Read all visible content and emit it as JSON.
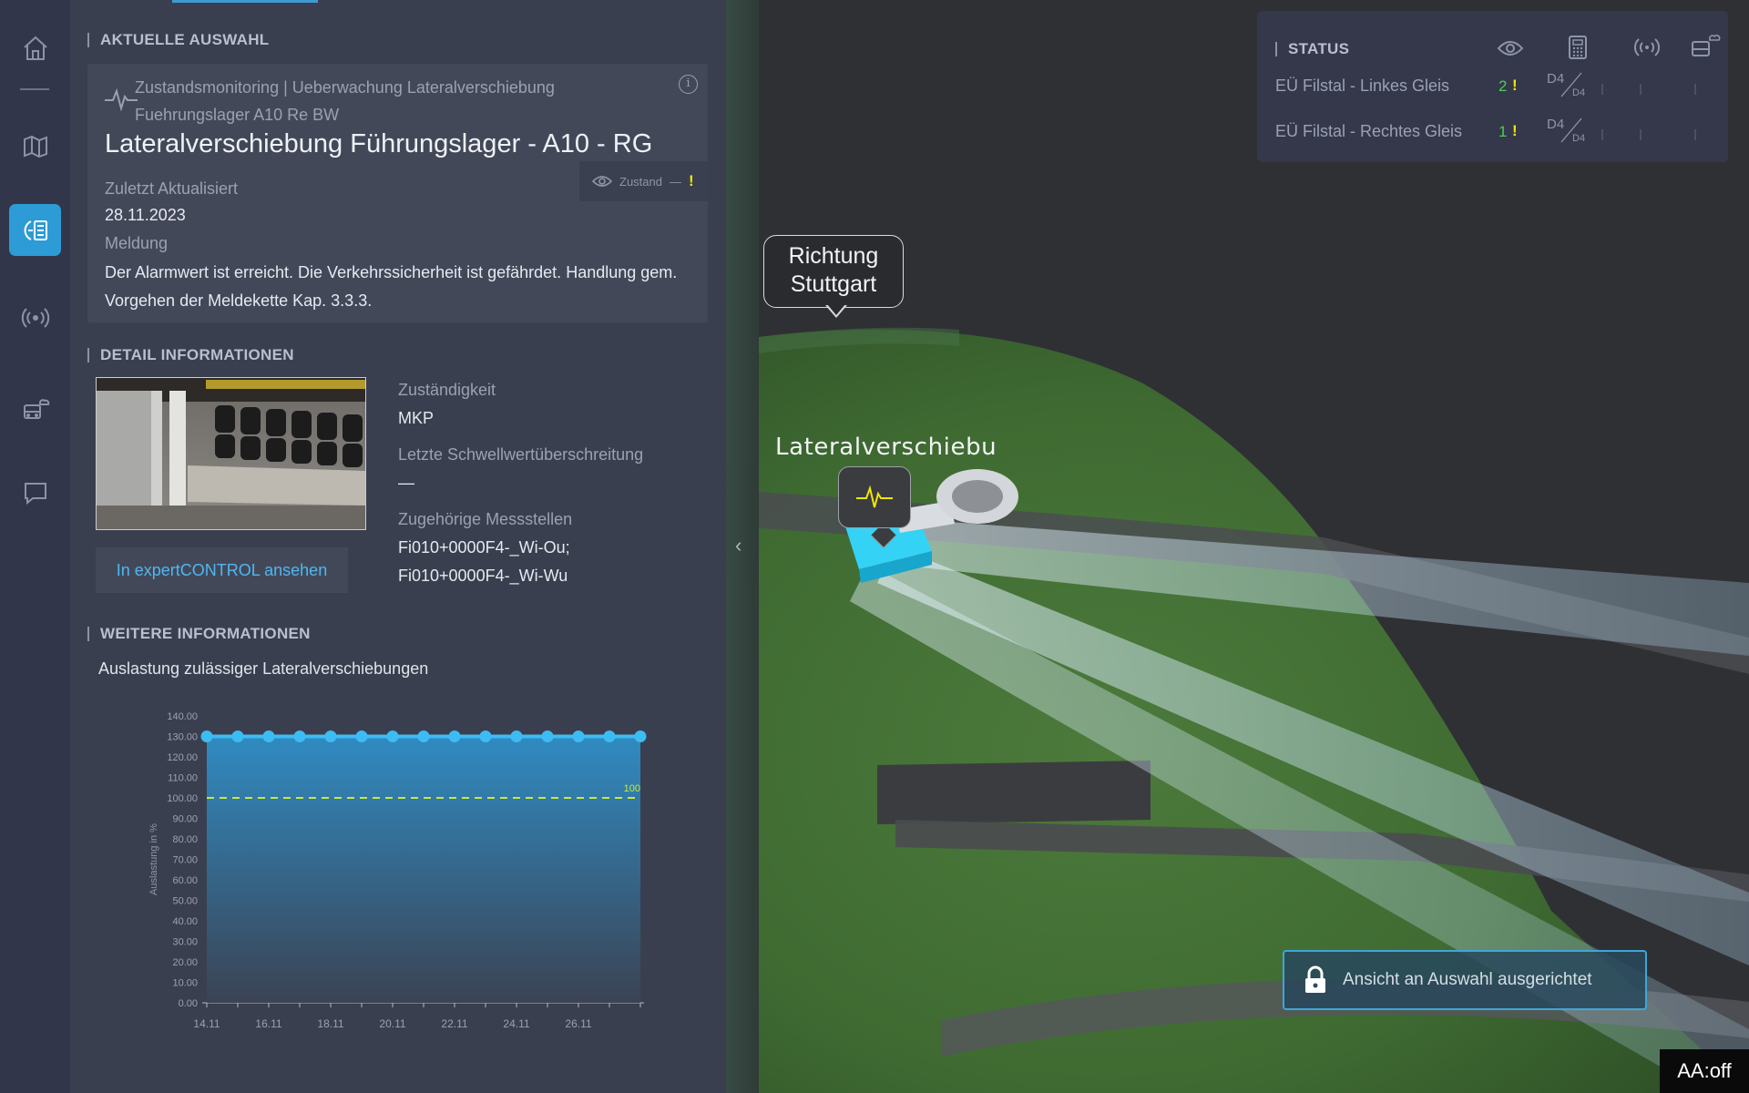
{
  "current_selection": {
    "section_title": "AKTUELLE AUSWAHL",
    "type_line": "Zustandsmonitoring | Ueberwachung Lateralverschiebung Fuehrungslager A10 Re BW",
    "title": "Lateralverschiebung Führungslager - A10 - RG",
    "zustand_label": "Zustand",
    "zustand_value": "—",
    "zustand_flag": "!",
    "updated_label": "Zuletzt Aktualisiert",
    "updated_value": "28.11.2023",
    "message_label": "Meldung",
    "message_value": "Der Alarmwert ist erreicht. Die Verkehrssicherheit ist gefährdet. Handlung gem. Vorgehen der Meldekette Kap. 3.3.3."
  },
  "detail": {
    "section_title": "DETAIL INFORMATIONEN",
    "responsibility_label": "Zuständigkeit",
    "responsibility_value": "MKP",
    "threshold_label": "Letzte Schwellwertüberschreitung",
    "threshold_value": "—",
    "points_label": "Zugehörige Messstellen",
    "point_1": "Fi010+0000F4-_Wi-Ou;",
    "point_2": "Fi010+0000F4-_Wi-Wu",
    "expert_button": "In expertCONTROL ansehen"
  },
  "further": {
    "section_title": "WEITERE INFORMATIONEN",
    "chart_caption": "Auslastung zulässiger Lateralverschiebungen"
  },
  "chart_data": {
    "type": "area",
    "title": "Auslastung zulässiger Lateralverschiebungen",
    "ylabel": "Auslastung in %",
    "xlabel": "",
    "x": [
      "14.11",
      "15.11",
      "16.11",
      "17.11",
      "18.11",
      "19.11",
      "20.11",
      "21.11",
      "22.11",
      "23.11",
      "24.11",
      "25.11",
      "26.11",
      "27.11",
      "28.11"
    ],
    "x_tick_labels": [
      "14.11",
      "16.11",
      "18.11",
      "20.11",
      "22.11",
      "24.11",
      "26.11"
    ],
    "series": [
      {
        "values": [
          130,
          130,
          130,
          130,
          130,
          130,
          130,
          130,
          130,
          130,
          130,
          130,
          130,
          130,
          130
        ]
      }
    ],
    "threshold": {
      "value": 100,
      "label": "100"
    },
    "y_ticks": [
      "0.00",
      "10.00",
      "20.00",
      "30.00",
      "40.00",
      "50.00",
      "60.00",
      "70.00",
      "80.00",
      "90.00",
      "100.00",
      "110.00",
      "120.00",
      "130.00",
      "140.00"
    ],
    "ylim": [
      0,
      140
    ],
    "colors": {
      "line": "#3cbcf3",
      "threshold": "#c9e83b",
      "area_top": "#2f8fc7",
      "area_bottom": "#3b4354"
    }
  },
  "status": {
    "section_title": "STATUS",
    "columns": [
      "eye-icon",
      "calculator-icon",
      "signal-icon",
      "train-cloud-icon"
    ],
    "rows": [
      {
        "name": "EÜ Filstal - Linkes Gleis",
        "count": "2",
        "flag": "!",
        "frac_top": "D4",
        "frac_bottom": "D4"
      },
      {
        "name": "EÜ Filstal - Rechtes Gleis",
        "count": "1",
        "flag": "!",
        "frac_top": "D4",
        "frac_bottom": "D4"
      }
    ]
  },
  "viewport": {
    "bubble_line1": "Richtung",
    "bubble_line2": "Stuttgart",
    "object_label": "Lateralverschiebu",
    "lock_note": "Ansicht an Auswahl ausgerichtet",
    "aa_indicator": "AA:off"
  },
  "nav": {
    "items": [
      "home-icon",
      "map-icon",
      "monitoring-icon",
      "signal-icon",
      "train-cloud-icon",
      "chat-icon"
    ]
  }
}
